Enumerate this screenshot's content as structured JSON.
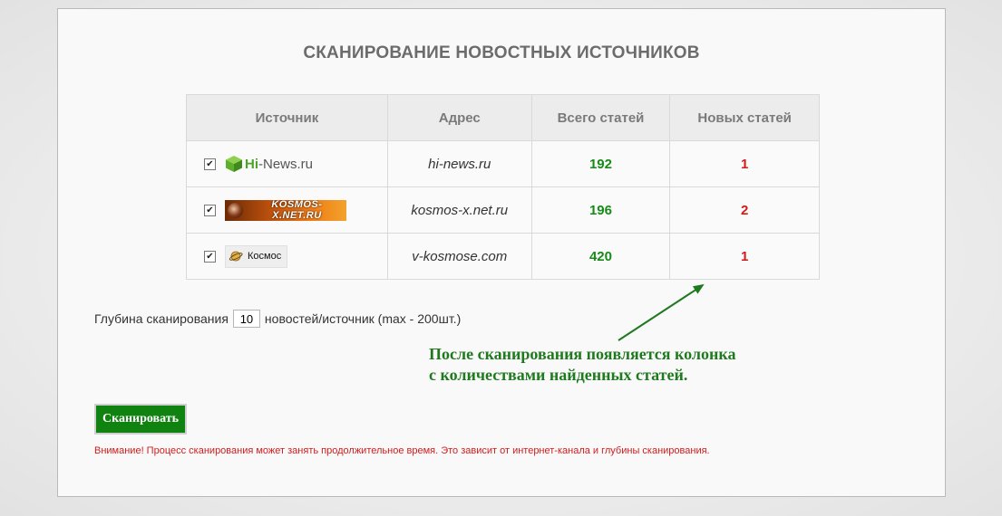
{
  "page": {
    "title": "СКАНИРОВАНИЕ НОВОСТНЫХ ИСТОЧНИКОВ"
  },
  "table": {
    "headers": [
      "Источник",
      "Адрес",
      "Всего статей",
      "Новых статей"
    ],
    "rows": [
      {
        "checked": true,
        "logo": "hi-news-logo",
        "logo_text_a": "Hi",
        "logo_text_b": "-News.ru",
        "address": "hi-news.ru",
        "total": "192",
        "new": "1"
      },
      {
        "checked": true,
        "logo": "kosmos-x-logo",
        "logo_text_a": "KOSMOS-X.NET.RU",
        "logo_text_b": "",
        "address": "kosmos-x.net.ru",
        "total": "196",
        "new": "2"
      },
      {
        "checked": true,
        "logo": "kosmos-logo",
        "logo_text_a": "Космос",
        "logo_text_b": "",
        "address": "v-kosmose.com",
        "total": "420",
        "new": "1"
      }
    ]
  },
  "depth": {
    "label": "Глубина сканирования",
    "value": "10",
    "suffix": "новостей/источник (max - 200шт.)"
  },
  "annotation": {
    "line1": "После сканирования появляется колонка",
    "line2": "с количествами найденных статей."
  },
  "scan_button": "Сканировать",
  "warning": "Внимание! Процесс сканирования может занять продолжительное время. Это зависит от интернет-канала и глубины сканирования.",
  "colors": {
    "accent_green": "#0f820f",
    "total_green": "#178a17",
    "new_red": "#d41a1a"
  }
}
